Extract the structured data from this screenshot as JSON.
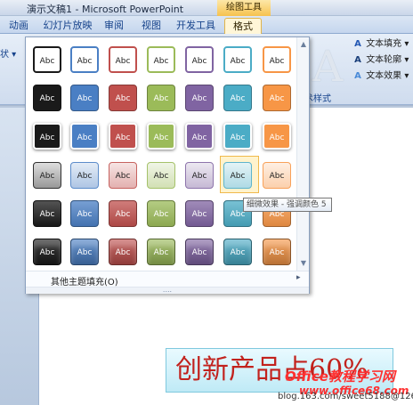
{
  "window": {
    "title": "演示文稿1 - Microsoft PowerPoint",
    "tools_label": "绘图工具"
  },
  "tabs": [
    "动画",
    "幻灯片放映",
    "审阅",
    "视图",
    "开发工具",
    "格式"
  ],
  "active_tab": "格式",
  "ribbon": {
    "left_fragment": "状 ▾",
    "wordart_letter": "A",
    "buttons": [
      {
        "icon": "text-fill-icon",
        "glyph": "A",
        "label": "文本填充 ▾"
      },
      {
        "icon": "text-outline-icon",
        "glyph": "A",
        "label": "文本轮廓 ▾"
      },
      {
        "icon": "text-effects-icon",
        "glyph": "A",
        "label": "文本效果 ▾"
      }
    ],
    "group_label": "术样式"
  },
  "gallery": {
    "cell_text": "Abc",
    "row_count": 6,
    "column_count": 7,
    "colors": [
      "#1a1a1a",
      "#4a7fc4",
      "#c0504d",
      "#9bbb59",
      "#8064a2",
      "#4bacc6",
      "#f79646"
    ],
    "scroll_up": "▲",
    "scroll_down": "▼",
    "footer_label": "其他主题填充(O)",
    "footer_chevron": "▸",
    "grip": "....",
    "selected": {
      "row": 4,
      "col": 6
    }
  },
  "tooltip": "细微效果 - 强调颜色 5",
  "slide": {
    "text": "创新产品占60%",
    "watermark": "Office教程学习网",
    "watermark2": "www.office68.com",
    "blog": "blog.163.com/sweet5188@126"
  }
}
